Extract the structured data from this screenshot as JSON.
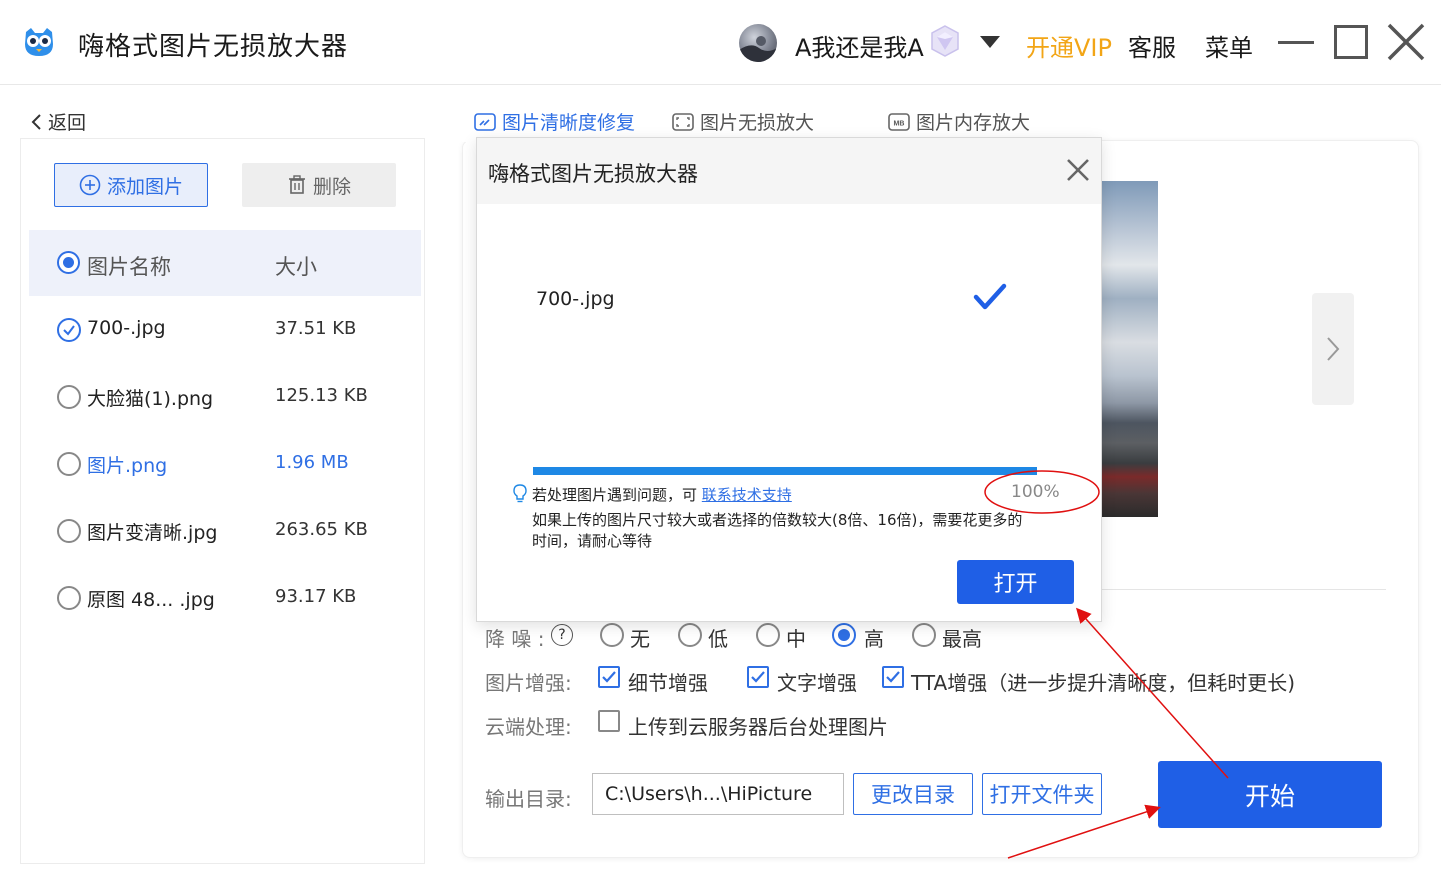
{
  "app": {
    "title": "嗨格式图片无损放大器",
    "username": "A我还是我A",
    "vip_label": "开通VIP",
    "service_label": "客服",
    "menu_label": "菜单"
  },
  "left": {
    "back_label": "返回",
    "add_label": "添加图片",
    "delete_label": "删除",
    "header": {
      "name": "图片名称",
      "size": "大小"
    },
    "files": [
      {
        "name": "700-.jpg",
        "size": "37.51 KB",
        "status": "done"
      },
      {
        "name": "大脸猫(1).png",
        "size": "125.13 KB",
        "status": "idle"
      },
      {
        "name": "图片.png",
        "size": "1.96 MB",
        "status": "highlight"
      },
      {
        "name": "图片变清晰.jpg",
        "size": "263.65 KB",
        "status": "idle"
      },
      {
        "name": "原图 48... .jpg",
        "size": "93.17 KB",
        "status": "idle"
      }
    ]
  },
  "tabs": [
    {
      "label": "图片清晰度修复",
      "icon": "image-repair-icon",
      "active": true
    },
    {
      "label": "图片无损放大",
      "icon": "expand-icon",
      "active": false
    },
    {
      "label": "图片内存放大",
      "icon": "mb-icon",
      "active": false
    }
  ],
  "options": {
    "denoise": {
      "label": "降 噪 :",
      "choices": [
        "无",
        "低",
        "中",
        "高",
        "最高"
      ],
      "selected": "高"
    },
    "enhance": {
      "label": "图片增强:",
      "items": [
        {
          "text": "细节增强",
          "checked": true
        },
        {
          "text": "文字增强",
          "checked": true
        },
        {
          "text": "TTA增强（进一步提升清晰度，但耗时更长)",
          "checked": true
        }
      ]
    },
    "cloud": {
      "label": "云端处理:",
      "text": "上传到云服务器后台处理图片",
      "checked": false
    },
    "output": {
      "label": "输出目录:",
      "path": "C:\\Users\\h...\\HiPicture",
      "change_label": "更改目录",
      "open_folder_label": "打开文件夹"
    },
    "start_label": "开始"
  },
  "modal": {
    "title": "嗨格式图片无损放大器",
    "file_name": "700-.jpg",
    "progress": 100,
    "progress_text": "100%",
    "hint_prefix": "若处理图片遇到问题，可",
    "hint_link": "联系技术支持",
    "hint_detail": "如果上传的图片尺寸较大或者选择的倍数较大(8倍、16倍)，需要花更多的时间，请耐心等待",
    "open_label": "打开"
  },
  "colors": {
    "accent": "#1f5fe6",
    "vip": "#f2a516",
    "annotation": "#e01010"
  }
}
